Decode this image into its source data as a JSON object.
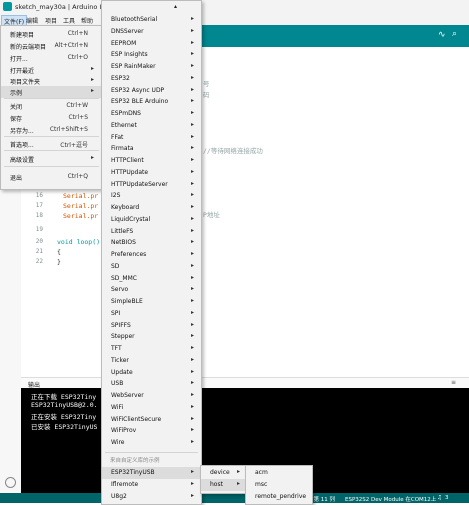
{
  "window": {
    "title": "sketch_may30a | Arduino IDE 2.3..."
  },
  "menubar": {
    "file": "文件(F)",
    "edit": "编辑",
    "sketch": "项目",
    "tools": "工具",
    "help": "帮助"
  },
  "file_menu": {
    "items": [
      {
        "label": "新建项目",
        "shortcut": "Ctrl+N"
      },
      {
        "label": "新的云端项目",
        "shortcut": "Alt+Ctrl+N"
      },
      {
        "label": "打开...",
        "shortcut": "Ctrl+O"
      },
      {
        "label": "打开最近",
        "submenu": true
      },
      {
        "label": "项目文件夹",
        "submenu": true
      },
      {
        "label": "示例",
        "submenu": true
      },
      {
        "label": "关闭",
        "shortcut": "Ctrl+W"
      },
      {
        "label": "保存",
        "shortcut": "Ctrl+S"
      },
      {
        "label": "另存为...",
        "shortcut": "Ctrl+Shift+S"
      },
      {
        "label": "首选项...",
        "shortcut": "Ctrl+逗号"
      },
      {
        "label": "高级设置",
        "submenu": true
      },
      {
        "label": "退出",
        "shortcut": "Ctrl+Q"
      }
    ]
  },
  "examples_menu": {
    "scroll_up": "▴",
    "items": [
      "BluetoothSerial",
      "DNSServer",
      "EEPROM",
      "ESP Insights",
      "ESP RainMaker",
      "ESP32",
      "ESP32 Async UDP",
      "ESP32 BLE Arduino",
      "ESPmDNS",
      "Ethernet",
      "FFat",
      "Firmata",
      "HTTPClient",
      "HTTPUpdate",
      "HTTPUpdateServer",
      "I2S",
      "Keyboard",
      "LiquidCrystal",
      "LittleFS",
      "NetBIOS",
      "Preferences",
      "SD",
      "SD_MMC",
      "Servo",
      "SimpleBLE",
      "SPI",
      "SPIFFS",
      "Stepper",
      "TFT",
      "Ticker",
      "Update",
      "USB",
      "WebServer",
      "WiFi",
      "WiFiClientSecure",
      "WiFiProv",
      "Wire"
    ],
    "custom_header": "来自自定义库的示例",
    "custom_items": [
      "ESP32TinyUSB",
      "Iflremote",
      "U8g2"
    ]
  },
  "tinyusb_menu": {
    "items": [
      "device",
      "host"
    ]
  },
  "host_menu": {
    "items": [
      "acm",
      "msc",
      "remote_pendrive"
    ]
  },
  "editor": {
    "line_numbers": [
      "15",
      "16",
      "17",
      "18",
      "19",
      "20",
      "21",
      "22"
    ],
    "lines": [
      "}",
      "Serial.pr",
      "Serial.pr",
      "Serial.pr",
      "",
      "void loop()",
      "{",
      "}"
    ],
    "fragments": [
      "号",
      "码",
      "//等待网络连接成功",
      "P地址"
    ]
  },
  "output": {
    "header": "输出",
    "lines": [
      "正在下载 ESP32Tiny",
      "ESP32TinyUSB@2.0.",
      "正在安装 ESP32Tiny",
      "已安装 ESP32TinyUS"
    ]
  },
  "status": {
    "position": "第 1 行，第 11 列",
    "board": "ESP32S2 Dev Module 在COM12上",
    "notifications": "3"
  },
  "colors": {
    "toolbar": "#00878f",
    "statusbar": "#006468",
    "keyword": "#00979d",
    "string": "#d35400"
  }
}
